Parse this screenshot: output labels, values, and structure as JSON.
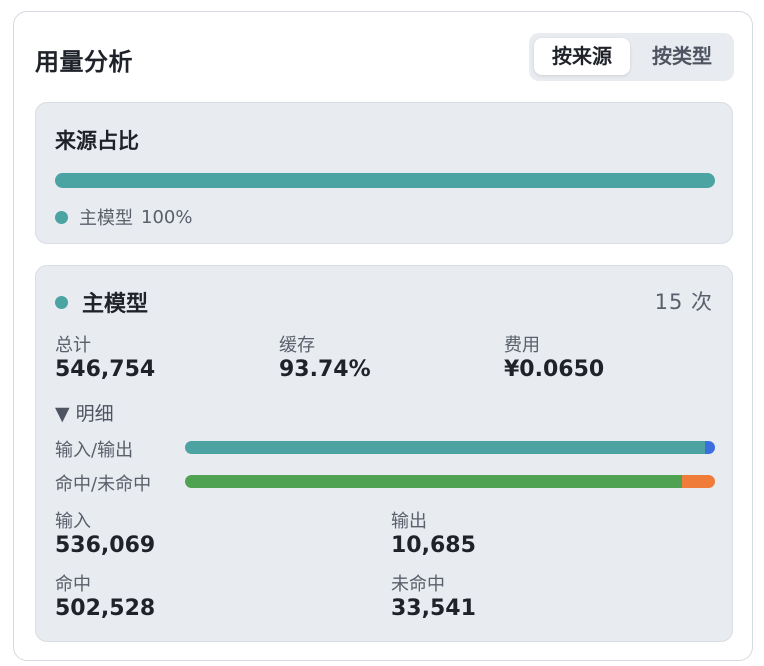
{
  "header": {
    "title": "用量分析",
    "tabs": [
      {
        "label": "按来源",
        "active": true
      },
      {
        "label": "按类型",
        "active": false
      }
    ]
  },
  "source_share": {
    "heading": "来源占比",
    "legend": [
      {
        "name": "主模型",
        "percent_text": "100%",
        "fraction": 1.0,
        "color": "#4ba3a2"
      }
    ]
  },
  "model": {
    "name": "主模型",
    "dot_color": "#4ba3a2",
    "count": "15 次",
    "stats": [
      {
        "label": "总计",
        "value": "546,754"
      },
      {
        "label": "缓存",
        "value": "93.74%"
      },
      {
        "label": "费用",
        "value": "¥0.0650"
      }
    ],
    "detail_toggle": "▼ 明细",
    "bars": [
      {
        "label": "输入/输出",
        "segments": [
          {
            "fraction": 0.9805,
            "color": "#4ba3a2"
          },
          {
            "fraction": 0.0195,
            "color": "#3b6fe0"
          }
        ]
      },
      {
        "label": "命中/未命中",
        "segments": [
          {
            "fraction": 0.9374,
            "color": "#4fa251"
          },
          {
            "fraction": 0.0626,
            "color": "#f07c3a"
          }
        ]
      }
    ],
    "breakdown": [
      {
        "label": "输入",
        "value": "536,069"
      },
      {
        "label": "输出",
        "value": "10,685"
      },
      {
        "label": "命中",
        "value": "502,528"
      },
      {
        "label": "未命中",
        "value": "33,541"
      }
    ]
  }
}
